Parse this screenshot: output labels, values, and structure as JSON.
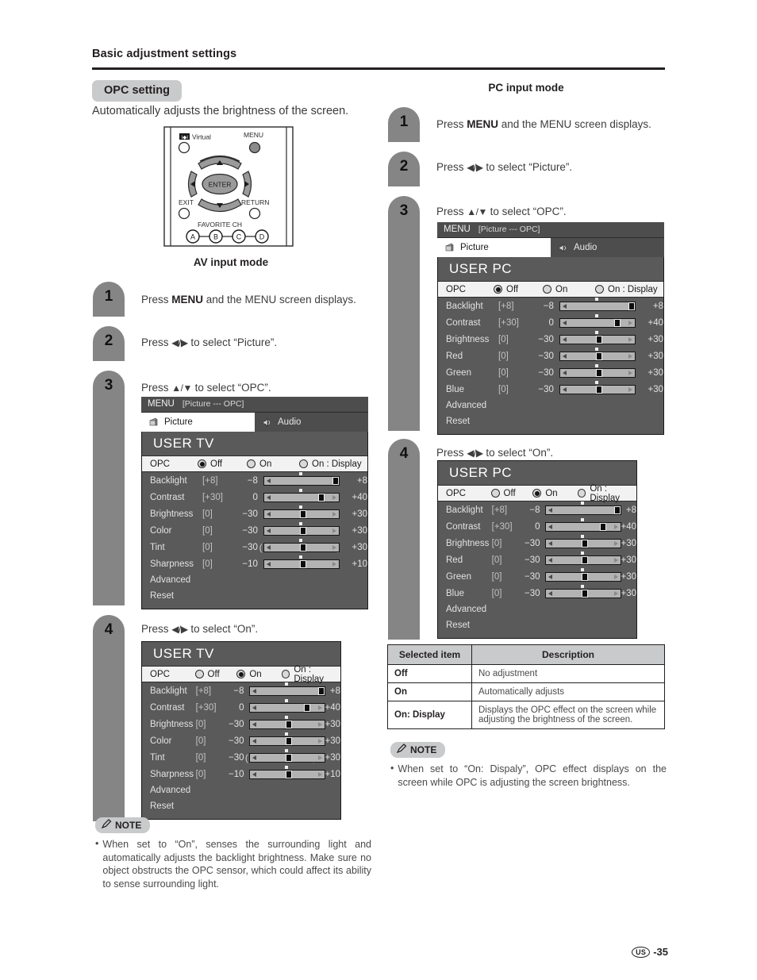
{
  "page": {
    "title": "Basic adjustment settings",
    "section_tag": "OPC setting",
    "intro": "Automatically adjusts the brightness of the screen.",
    "footer_region": "US",
    "footer_page": "-35"
  },
  "remote": {
    "virtual_label": "Virtual",
    "menu_label": "MENU",
    "enter_label": "ENTER",
    "exit_label": "EXIT",
    "return_label": "RETURN",
    "favorite_label": "FAVORITE CH",
    "color_buttons": [
      "A",
      "B",
      "C",
      "D"
    ]
  },
  "av": {
    "heading": "AV input mode",
    "steps": [
      {
        "num": "1",
        "text_pre": "Press ",
        "text_bold": "MENU",
        "text_post": " and the MENU screen displays."
      },
      {
        "num": "2",
        "text_pre": "Press ",
        "arrows": "◀/▶",
        "text_post": " to select “Picture”."
      },
      {
        "num": "3",
        "text_pre": "Press ",
        "arrows": "▲/▼",
        "text_post": " to select “OPC”."
      },
      {
        "num": "4",
        "text_pre": "Press ",
        "arrows": "◀/▶",
        "text_post": " to select “On”."
      }
    ]
  },
  "pc": {
    "heading": "PC input mode",
    "steps": [
      {
        "num": "1",
        "text_pre": "Press ",
        "text_bold": "MENU",
        "text_post": " and the MENU screen displays."
      },
      {
        "num": "2",
        "text_pre": "Press ",
        "arrows": "◀/▶",
        "text_post": " to select “Picture”."
      },
      {
        "num": "3",
        "text_pre": "Press ",
        "arrows": "▲/▼",
        "text_post": " to select “OPC”."
      },
      {
        "num": "4",
        "text_pre": "Press ",
        "arrows": "◀/▶",
        "text_post": " to select “On”."
      }
    ]
  },
  "osd_common": {
    "menubar_title": "MENU",
    "menubar_path": "[Picture --- OPC]",
    "tab_picture": "Picture",
    "tab_audio": "Audio",
    "opc_label": "OPC",
    "opc_options": [
      "Off",
      "On",
      "On : Display"
    ],
    "advanced_label": "Advanced",
    "reset_label": "Reset"
  },
  "osd_tv": {
    "title": "USER TV",
    "rows": [
      {
        "name": "Backlight",
        "cur": "[+8]",
        "min": "-8",
        "max": "+8",
        "pos": 86,
        "paren": false
      },
      {
        "name": "Contrast",
        "cur": "[+30]",
        "min": "0",
        "max": "+40",
        "pos": 68,
        "paren": false
      },
      {
        "name": "Brightness",
        "cur": "[0]",
        "min": "-30",
        "max": "+30",
        "pos": 45,
        "paren": false
      },
      {
        "name": "Color",
        "cur": "[0]",
        "min": "-30",
        "max": "+30",
        "pos": 45,
        "paren": false
      },
      {
        "name": "Tint",
        "cur": "[0]",
        "min": "-30",
        "max": "+30",
        "pos": 45,
        "paren": true
      },
      {
        "name": "Sharpness",
        "cur": "[0]",
        "min": "-10",
        "max": "+10",
        "pos": 45,
        "paren": false
      }
    ]
  },
  "osd_pc": {
    "title": "USER PC",
    "rows": [
      {
        "name": "Backlight",
        "cur": "[+8]",
        "min": "-8",
        "max": "+8",
        "pos": 86,
        "paren": false
      },
      {
        "name": "Contrast",
        "cur": "[+30]",
        "min": "0",
        "max": "+40",
        "pos": 68,
        "paren": false
      },
      {
        "name": "Brightness",
        "cur": "[0]",
        "min": "-30",
        "max": "+30",
        "pos": 45,
        "paren": false
      },
      {
        "name": "Red",
        "cur": "[0]",
        "min": "-30",
        "max": "+30",
        "pos": 45,
        "paren": false
      },
      {
        "name": "Green",
        "cur": "[0]",
        "min": "-30",
        "max": "+30",
        "pos": 45,
        "paren": false
      },
      {
        "name": "Blue",
        "cur": "[0]",
        "min": "-30",
        "max": "+30",
        "pos": 45,
        "paren": false
      }
    ]
  },
  "selection_states": {
    "step3_selected": "Off",
    "step4_selected": "On"
  },
  "desc_table": {
    "headers": [
      "Selected item",
      "Description"
    ],
    "rows": [
      {
        "item": "Off",
        "desc": "No adjustment"
      },
      {
        "item": "On",
        "desc": "Automatically adjusts"
      },
      {
        "item": "On: Display",
        "desc": "Displays the OPC effect on the screen while adjusting the brightness of the screen."
      }
    ]
  },
  "note_left": {
    "label": "NOTE",
    "bullet": "•",
    "text": "When set to “On”, senses the surrounding light and automatically adjusts the backlight brightness. Make sure no object obstructs the OPC sensor, which could affect its ability to sense surrounding light."
  },
  "note_right": {
    "label": "NOTE",
    "bullet": "•",
    "text": "When set to “On: Dispaly”, OPC effect displays on the screen while OPC is adjusting the screen brightness."
  },
  "colors": {
    "accent_gray": "#858585",
    "tag_gray": "#c9cacb",
    "osd_body": "#5a5a5a",
    "osd_bar": "#4d4d4d",
    "ink": "#231f20"
  }
}
